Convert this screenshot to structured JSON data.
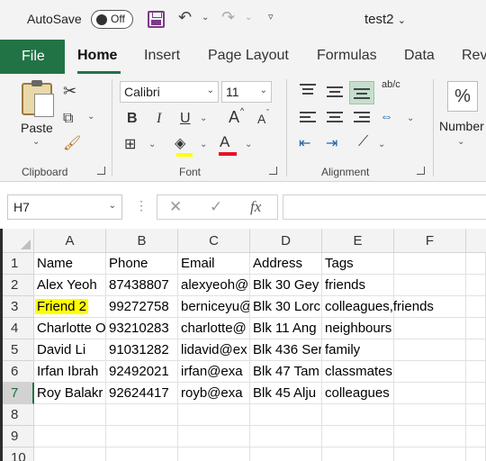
{
  "titlebar": {
    "autosave_label": "AutoSave",
    "autosave_state": "Off",
    "document_title": "test2"
  },
  "ribbon_tabs": [
    "File",
    "Home",
    "Insert",
    "Page Layout",
    "Formulas",
    "Data",
    "Rev"
  ],
  "active_tab": "Home",
  "ribbon": {
    "clipboard": {
      "paste_label": "Paste",
      "group_label": "Clipboard"
    },
    "font": {
      "name": "Calibri",
      "size": "11",
      "group_label": "Font",
      "bold": "B",
      "italic": "I",
      "underline": "U",
      "grow": "A",
      "shrink": "A",
      "font_color_letter": "A"
    },
    "alignment": {
      "group_label": "Alignment",
      "wrap_icon": "ab/c"
    },
    "number": {
      "label": "Number",
      "format_symbol": "%"
    }
  },
  "formula_bar": {
    "name_box": "H7",
    "cancel": "✕",
    "enter": "✓",
    "fx": "fx",
    "value": ""
  },
  "sheet": {
    "columns": [
      "A",
      "B",
      "C",
      "D",
      "E",
      "F"
    ],
    "rows": [
      "1",
      "2",
      "3",
      "4",
      "5",
      "6",
      "7",
      "8",
      "9",
      "10"
    ],
    "active_row": "7",
    "cells": [
      [
        "Name",
        "Phone",
        "Email",
        "Address",
        "Tags",
        ""
      ],
      [
        "Alex Yeoh",
        "87438807",
        "alexyeoh@",
        "Blk 30 Gey",
        "friends",
        ""
      ],
      [
        "Friend 2",
        "99272758",
        "berniceyu@",
        "Blk 30 Lorc",
        "colleagues,friends",
        ""
      ],
      [
        "Charlotte O",
        "93210283",
        "charlotte@",
        "Blk 11 Ang",
        "neighbours",
        ""
      ],
      [
        "David Li",
        "91031282",
        "lidavid@ex",
        "Blk 436 Ser",
        "family",
        ""
      ],
      [
        "Irfan Ibrah",
        "92492021",
        "irfan@exa",
        "Blk 47 Tam",
        "classmates",
        ""
      ],
      [
        "Roy Balakr",
        "92624417",
        "royb@exa",
        "Blk 45 Alju",
        "colleagues",
        ""
      ],
      [
        "",
        "",
        "",
        "",
        "",
        ""
      ],
      [
        "",
        "",
        "",
        "",
        "",
        ""
      ],
      [
        "",
        "",
        "",
        "",
        "",
        ""
      ]
    ],
    "highlighted_cell": "A3",
    "highlight_color": "#ffff00",
    "accent_color": "#217346"
  }
}
